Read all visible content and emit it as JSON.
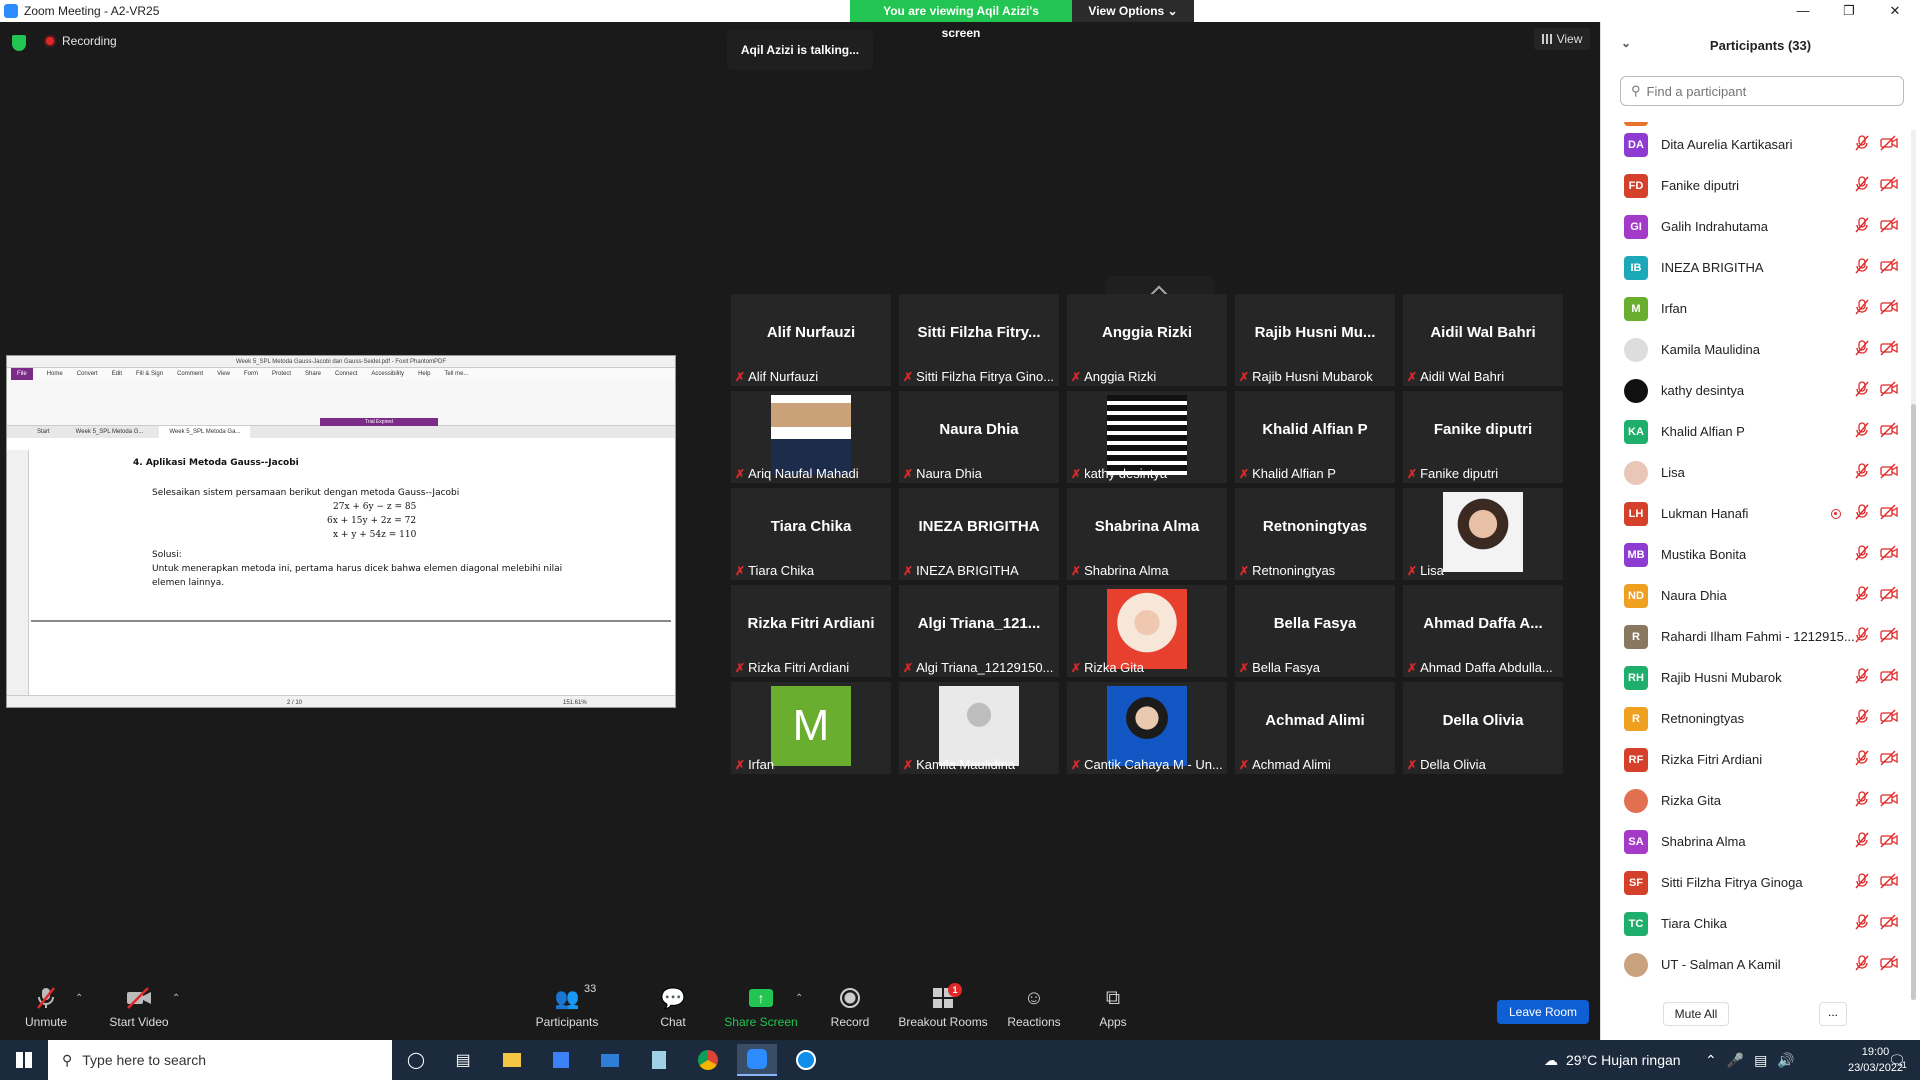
{
  "window": {
    "title": "Zoom Meeting - A2-VR25",
    "banner_text": "You are viewing Aqil Azizi's screen",
    "view_options": "View Options",
    "recording": "Recording",
    "talking": "Aqil Azizi is talking...",
    "view_label": "View"
  },
  "shared_doc": {
    "window_title": "Week 5_SPL Metoda Gauss-Jacobi dan Gauss-Seidel.pdf - Foxit PhantomPDF",
    "tabs": [
      "File",
      "Home",
      "Convert",
      "Edit",
      "Fill & Sign",
      "Comment",
      "View",
      "Form",
      "Protect",
      "Share",
      "Connect",
      "Accessibility",
      "Help",
      "Tell me..."
    ],
    "doc_tabs": [
      "Start",
      "Week 5_SPL Metoda G...",
      "Week 5_SPL Metoda Ga..."
    ],
    "trial": "Trial Expired",
    "heading": "4.   Aplikasi Metoda Gauss--Jacobi",
    "intro": "Selesaikan sistem persamaan berikut dengan metoda Gauss--Jacobi",
    "eq1": "27x + 6y − z = 85",
    "eq2": "6x + 15y + 2z = 72",
    "eq3": "x + y + 54z = 110",
    "solusi": "Solusi:",
    "body": "Untuk menerapkan metoda ini, pertama harus dicek bahwa elemen diagonal melebihi nilai elemen lainnya.",
    "page_indicator": "2 / 10",
    "zoom": "151.61%"
  },
  "gallery": [
    {
      "big": "Alif Nurfauzi",
      "label": "Alif Nurfauzi",
      "photo": ""
    },
    {
      "big": "Sitti Filzha Fitry...",
      "label": "Sitti Filzha Fitrya Gino...",
      "photo": ""
    },
    {
      "big": "Anggia Rizki",
      "label": "Anggia Rizki",
      "photo": ""
    },
    {
      "big": "Rajib Husni Mu...",
      "label": "Rajib Husni Mubarok",
      "photo": ""
    },
    {
      "big": "Aidil Wal Bahri",
      "label": "Aidil Wal Bahri",
      "photo": ""
    },
    {
      "big": "",
      "label": "Ariq Naufal Mahadi",
      "photo": "man"
    },
    {
      "big": "Naura Dhia",
      "label": "Naura Dhia",
      "photo": ""
    },
    {
      "big": "",
      "label": "kathy desintya",
      "photo": "stripes"
    },
    {
      "big": "Khalid Alfian P",
      "label": "Khalid Alfian P",
      "photo": ""
    },
    {
      "big": "Fanike diputri",
      "label": "Fanike diputri",
      "photo": ""
    },
    {
      "big": "Tiara Chika",
      "label": "Tiara Chika",
      "photo": ""
    },
    {
      "big": "INEZA BRIGITHA",
      "label": "INEZA BRIGITHA",
      "photo": ""
    },
    {
      "big": "Shabrina Alma",
      "label": "Shabrina Alma",
      "photo": ""
    },
    {
      "big": "Retnoningtyas",
      "label": "Retnoningtyas",
      "photo": ""
    },
    {
      "big": "",
      "label": "Lisa",
      "photo": "woman"
    },
    {
      "big": "Rizka Fitri Ardiani",
      "label": "Rizka Fitri Ardiani",
      "photo": ""
    },
    {
      "big": "Algi Triana_121...",
      "label": "Algi Triana_12129150...",
      "photo": ""
    },
    {
      "big": "",
      "label": "Rizka Gita",
      "photo": "hijab"
    },
    {
      "big": "Bella Fasya",
      "label": "Bella Fasya",
      "photo": ""
    },
    {
      "big": "Ahmad Daffa A...",
      "label": "Ahmad Daffa Abdulla...",
      "photo": ""
    },
    {
      "big": "",
      "label": "Irfan",
      "photo": "letter-m"
    },
    {
      "big": "",
      "label": "Kamila Maulidina",
      "photo": "silhouette"
    },
    {
      "big": "",
      "label": "Cantik Cahaya M - Un...",
      "photo": "blue"
    },
    {
      "big": "Achmad Alimi",
      "label": "Achmad Alimi",
      "photo": ""
    },
    {
      "big": "Della Olivia",
      "label": "Della Olivia",
      "photo": ""
    }
  ],
  "toolbar": {
    "unmute": "Unmute",
    "start_video": "Start Video",
    "participants": "Participants",
    "participants_count": "33",
    "chat": "Chat",
    "share_screen": "Share Screen",
    "record": "Record",
    "breakout": "Breakout Rooms",
    "breakout_badge": "1",
    "reactions": "Reactions",
    "apps": "Apps",
    "leave": "Leave Room"
  },
  "panel": {
    "title": "Participants (33)",
    "search_placeholder": "Find a participant",
    "mute_all": "Mute All",
    "more": "...",
    "participants": [
      {
        "initials": "DA",
        "name": "Dita Aurelia Kartikasari",
        "color": "#8e3bd1",
        "rec": false
      },
      {
        "initials": "FD",
        "name": "Fanike diputri",
        "color": "#d5402b",
        "rec": false
      },
      {
        "initials": "GI",
        "name": "Galih Indrahutama",
        "color": "#a43bc8",
        "rec": false
      },
      {
        "initials": "IB",
        "name": "INEZA BRIGITHA",
        "color": "#1ba8b8",
        "rec": false
      },
      {
        "initials": "M",
        "name": "Irfan",
        "color": "#6aae2f",
        "rec": false
      },
      {
        "initials": "",
        "name": "Kamila Maulidina",
        "color": "#dddddd",
        "rec": false
      },
      {
        "initials": "",
        "name": "kathy desintya",
        "color": "#111111",
        "rec": false
      },
      {
        "initials": "KA",
        "name": "Khalid Alfian P",
        "color": "#1fae6b",
        "rec": false
      },
      {
        "initials": "",
        "name": "Lisa",
        "color": "#e9c6b8",
        "rec": false
      },
      {
        "initials": "LH",
        "name": "Lukman Hanafi",
        "color": "#d5402b",
        "rec": true
      },
      {
        "initials": "MB",
        "name": "Mustika Bonita",
        "color": "#8e3bd1",
        "rec": false
      },
      {
        "initials": "ND",
        "name": "Naura Dhia",
        "color": "#f0a020",
        "rec": false
      },
      {
        "initials": "R",
        "name": "Rahardi Ilham Fahmi - 1212915...",
        "color": "#8a7760",
        "rec": false
      },
      {
        "initials": "RH",
        "name": "Rajib Husni Mubarok",
        "color": "#1fae6b",
        "rec": false
      },
      {
        "initials": "R",
        "name": "Retnoningtyas",
        "color": "#f0a020",
        "rec": false
      },
      {
        "initials": "RF",
        "name": "Rizka Fitri Ardiani",
        "color": "#d5402b",
        "rec": false
      },
      {
        "initials": "",
        "name": "Rizka Gita",
        "color": "#e07050",
        "rec": false
      },
      {
        "initials": "SA",
        "name": "Shabrina Alma",
        "color": "#a43bc8",
        "rec": false
      },
      {
        "initials": "SF",
        "name": "Sitti Filzha Fitrya Ginoga",
        "color": "#d5402b",
        "rec": false
      },
      {
        "initials": "TC",
        "name": "Tiara Chika",
        "color": "#1fae6b",
        "rec": false
      },
      {
        "initials": "",
        "name": "UT - Salman A Kamil",
        "color": "#c9a27e",
        "rec": false
      }
    ]
  },
  "taskbar": {
    "search_placeholder": "Type here to search",
    "weather": "29°C  Hujan ringan",
    "time": "19:00",
    "date": "23/03/2022",
    "notif_count": "1"
  }
}
